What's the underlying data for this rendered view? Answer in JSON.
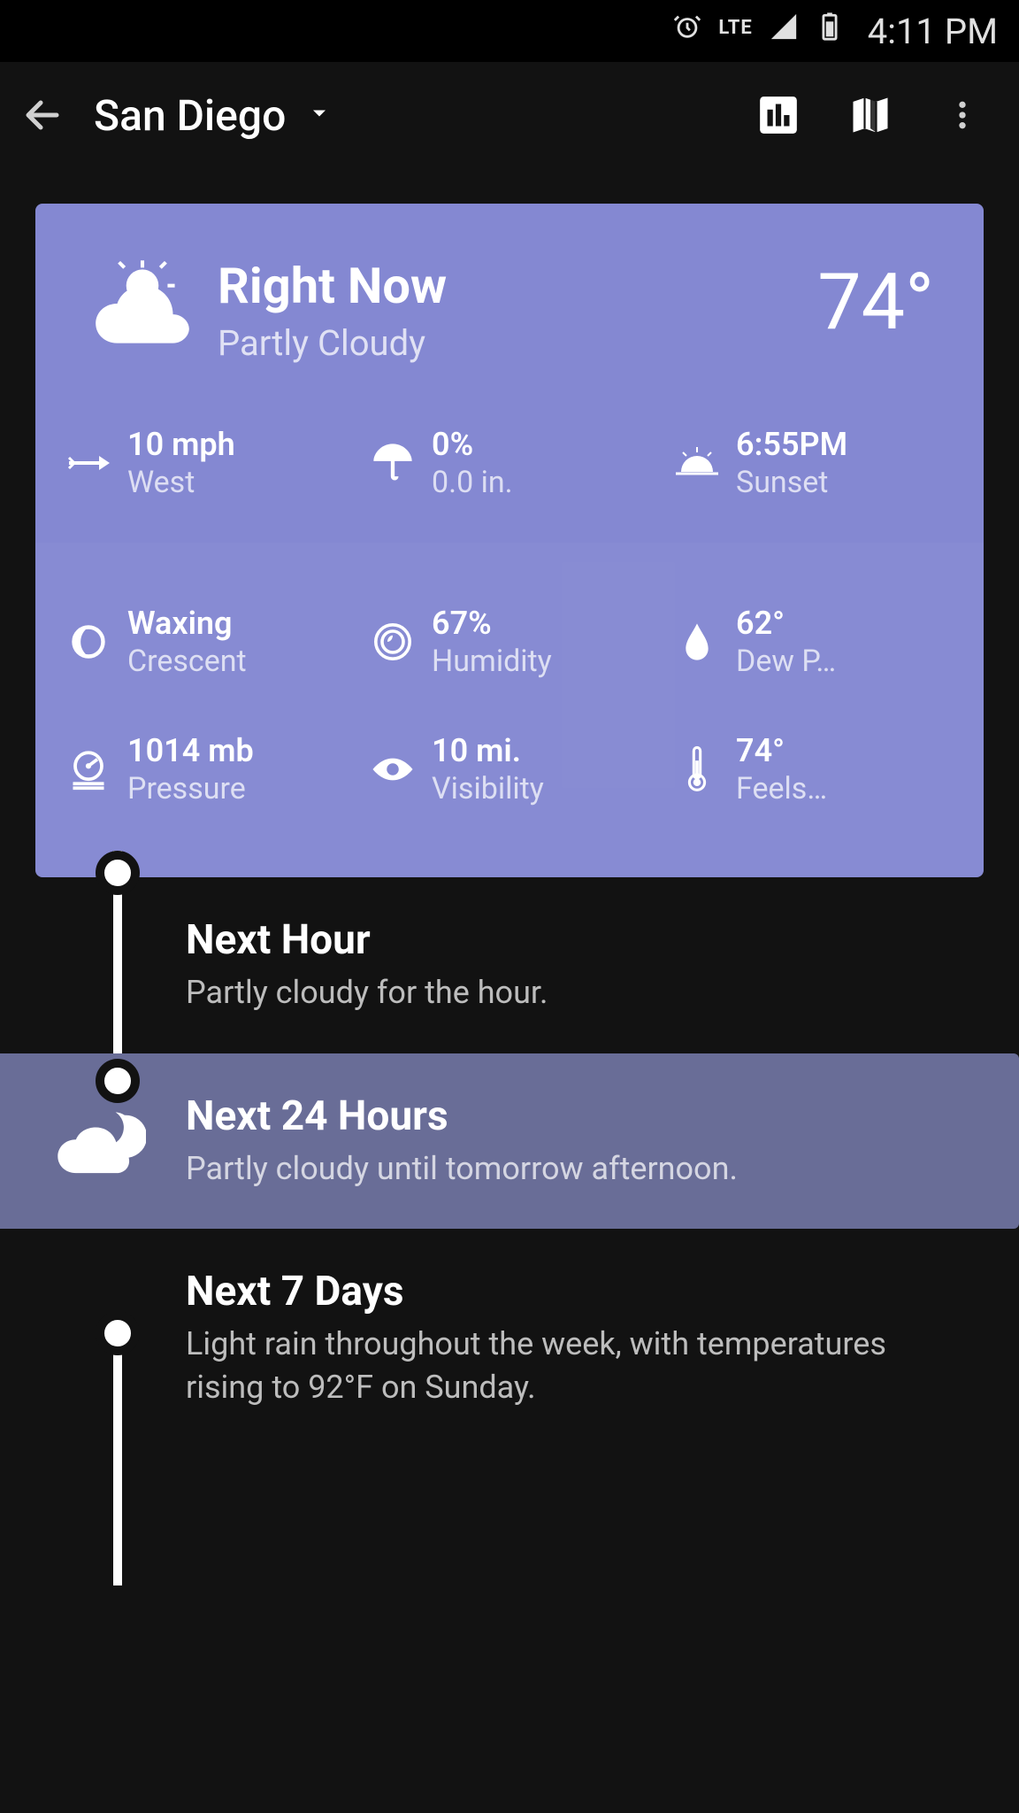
{
  "status_bar": {
    "network": "LTE",
    "time": "4:11 PM"
  },
  "app_bar": {
    "location": "San Diego"
  },
  "now": {
    "title": "Right Now",
    "condition": "Partly Cloudy",
    "temperature": "74°",
    "metrics_top": [
      {
        "value": "10 mph",
        "label": "West",
        "icon": "wind-arrow"
      },
      {
        "value": "0%",
        "label": "0.0 in.",
        "icon": "umbrella"
      },
      {
        "value": "6:55PM",
        "label": "Sunset",
        "icon": "sunset"
      }
    ],
    "metrics_bottom1": [
      {
        "value": "Waxing",
        "label": "Crescent",
        "icon": "moon"
      },
      {
        "value": "67%",
        "label": "Humidity",
        "icon": "humidity"
      },
      {
        "value": "62°",
        "label": "Dew P…",
        "icon": "droplet"
      }
    ],
    "metrics_bottom2": [
      {
        "value": "1014 mb",
        "label": "Pressure",
        "icon": "pressure"
      },
      {
        "value": "10 mi.",
        "label": "Visibility",
        "icon": "eye"
      },
      {
        "value": "74°",
        "label": "Feels…",
        "icon": "thermometer"
      }
    ]
  },
  "forecast": {
    "next_hour": {
      "title": "Next Hour",
      "desc": "Partly cloudy for the hour."
    },
    "next_24h": {
      "title": "Next 24 Hours",
      "desc": "Partly cloudy until tomorrow afternoon."
    },
    "next_7d": {
      "title": "Next 7 Days",
      "desc": "Light rain throughout the week, with temperatures rising to 92°F on Sunday."
    }
  }
}
